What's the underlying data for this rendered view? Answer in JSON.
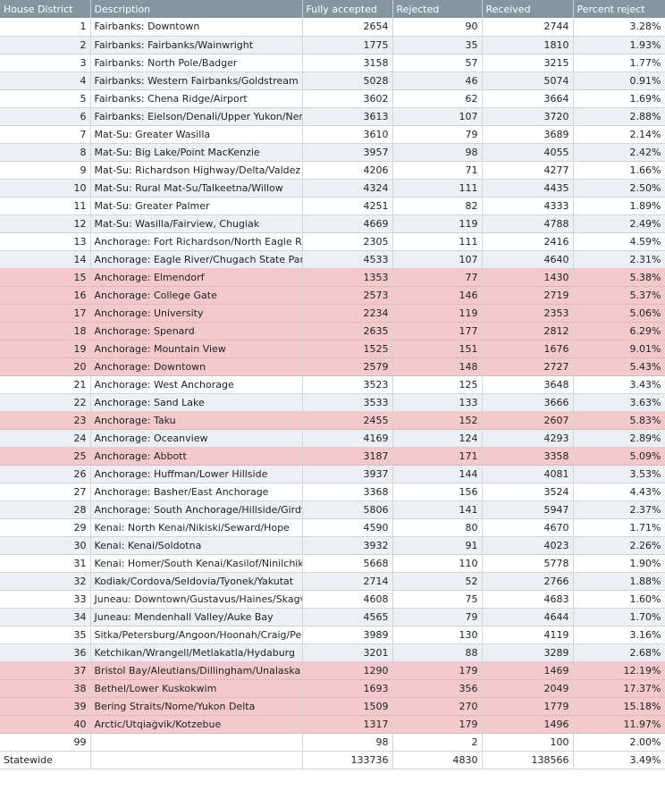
{
  "table": {
    "headers": [
      "House District",
      "Description",
      "Fully accepted",
      "Rejected",
      "Received",
      "Percent reject"
    ],
    "rows": [
      {
        "d": "1",
        "desc": "Fairbanks: Downtown",
        "acc": "2654",
        "rej": "90",
        "rec": "2744",
        "pct": "3.28%",
        "hl": false
      },
      {
        "d": "2",
        "desc": "Fairbanks: Fairbanks/Wainwright",
        "acc": "1775",
        "rej": "35",
        "rec": "1810",
        "pct": "1.93%",
        "hl": false
      },
      {
        "d": "3",
        "desc": "Fairbanks: North Pole/Badger",
        "acc": "3158",
        "rej": "57",
        "rec": "3215",
        "pct": "1.77%",
        "hl": false
      },
      {
        "d": "4",
        "desc": "Fairbanks: Western Fairbanks/Goldstream",
        "acc": "5028",
        "rej": "46",
        "rec": "5074",
        "pct": "0.91%",
        "hl": false
      },
      {
        "d": "5",
        "desc": "Fairbanks: Chena Ridge/Airport",
        "acc": "3602",
        "rej": "62",
        "rec": "3664",
        "pct": "1.69%",
        "hl": false
      },
      {
        "d": "6",
        "desc": "Fairbanks: Eielson/Denali/Upper Yukon/Ner",
        "acc": "3613",
        "rej": "107",
        "rec": "3720",
        "pct": "2.88%",
        "hl": false
      },
      {
        "d": "7",
        "desc": "Mat-Su: Greater Wasilla",
        "acc": "3610",
        "rej": "79",
        "rec": "3689",
        "pct": "2.14%",
        "hl": false
      },
      {
        "d": "8",
        "desc": "Mat-Su: Big Lake/Point MacKenzie",
        "acc": "3957",
        "rej": "98",
        "rec": "4055",
        "pct": "2.42%",
        "hl": false
      },
      {
        "d": "9",
        "desc": "Mat-Su: Richardson Highway/Delta/Valdez",
        "acc": "4206",
        "rej": "71",
        "rec": "4277",
        "pct": "1.66%",
        "hl": false
      },
      {
        "d": "10",
        "desc": "Mat-Su: Rural Mat-Su/Talkeetna/Willow",
        "acc": "4324",
        "rej": "111",
        "rec": "4435",
        "pct": "2.50%",
        "hl": false
      },
      {
        "d": "11",
        "desc": "Mat-Su: Greater Palmer",
        "acc": "4251",
        "rej": "82",
        "rec": "4333",
        "pct": "1.89%",
        "hl": false
      },
      {
        "d": "12",
        "desc": "Mat-Su: Wasilla/Fairview, Chugiak",
        "acc": "4669",
        "rej": "119",
        "rec": "4788",
        "pct": "2.49%",
        "hl": false
      },
      {
        "d": "13",
        "desc": "Anchorage: Fort Richardson/North Eagle Ri",
        "acc": "2305",
        "rej": "111",
        "rec": "2416",
        "pct": "4.59%",
        "hl": false
      },
      {
        "d": "14",
        "desc": "Anchorage: Eagle River/Chugach State Park",
        "acc": "4533",
        "rej": "107",
        "rec": "4640",
        "pct": "2.31%",
        "hl": false
      },
      {
        "d": "15",
        "desc": "Anchorage: Elmendorf",
        "acc": "1353",
        "rej": "77",
        "rec": "1430",
        "pct": "5.38%",
        "hl": true
      },
      {
        "d": "16",
        "desc": "Anchorage: College Gate",
        "acc": "2573",
        "rej": "146",
        "rec": "2719",
        "pct": "5.37%",
        "hl": true
      },
      {
        "d": "17",
        "desc": "Anchorage: University",
        "acc": "2234",
        "rej": "119",
        "rec": "2353",
        "pct": "5.06%",
        "hl": true
      },
      {
        "d": "18",
        "desc": "Anchorage: Spenard",
        "acc": "2635",
        "rej": "177",
        "rec": "2812",
        "pct": "6.29%",
        "hl": true
      },
      {
        "d": "19",
        "desc": "Anchorage: Mountain View",
        "acc": "1525",
        "rej": "151",
        "rec": "1676",
        "pct": "9.01%",
        "hl": true
      },
      {
        "d": "20",
        "desc": "Anchorage: Downtown",
        "acc": "2579",
        "rej": "148",
        "rec": "2727",
        "pct": "5.43%",
        "hl": true
      },
      {
        "d": "21",
        "desc": "Anchorage: West Anchorage",
        "acc": "3523",
        "rej": "125",
        "rec": "3648",
        "pct": "3.43%",
        "hl": false
      },
      {
        "d": "22",
        "desc": "Anchorage: Sand Lake",
        "acc": "3533",
        "rej": "133",
        "rec": "3666",
        "pct": "3.63%",
        "hl": false
      },
      {
        "d": "23",
        "desc": "Anchorage: Taku",
        "acc": "2455",
        "rej": "152",
        "rec": "2607",
        "pct": "5.83%",
        "hl": true
      },
      {
        "d": "24",
        "desc": "Anchorage: Oceanview",
        "acc": "4169",
        "rej": "124",
        "rec": "4293",
        "pct": "2.89%",
        "hl": false
      },
      {
        "d": "25",
        "desc": "Anchorage: Abbott",
        "acc": "3187",
        "rej": "171",
        "rec": "3358",
        "pct": "5.09%",
        "hl": true
      },
      {
        "d": "26",
        "desc": "Anchorage: Huffman/Lower Hillside",
        "acc": "3937",
        "rej": "144",
        "rec": "4081",
        "pct": "3.53%",
        "hl": false
      },
      {
        "d": "27",
        "desc": "Anchorage: Basher/East Anchorage",
        "acc": "3368",
        "rej": "156",
        "rec": "3524",
        "pct": "4.43%",
        "hl": false
      },
      {
        "d": "28",
        "desc": "Anchorage: South Anchorage/Hillside/Girdv",
        "acc": "5806",
        "rej": "141",
        "rec": "5947",
        "pct": "2.37%",
        "hl": false
      },
      {
        "d": "29",
        "desc": "Kenai: North Kenai/Nikiski/Seward/Hope",
        "acc": "4590",
        "rej": "80",
        "rec": "4670",
        "pct": "1.71%",
        "hl": false
      },
      {
        "d": "30",
        "desc": "Kenai: Kenai/Soldotna",
        "acc": "3932",
        "rej": "91",
        "rec": "4023",
        "pct": "2.26%",
        "hl": false
      },
      {
        "d": "31",
        "desc": "Kenai: Homer/South Kenai/Kasilof/Ninilchik",
        "acc": "5668",
        "rej": "110",
        "rec": "5778",
        "pct": "1.90%",
        "hl": false
      },
      {
        "d": "32",
        "desc": "Kodiak/Cordova/Seldovia/Tyonek/Yakutat",
        "acc": "2714",
        "rej": "52",
        "rec": "2766",
        "pct": "1.88%",
        "hl": false
      },
      {
        "d": "33",
        "desc": "Juneau: Downtown/Gustavus/Haines/Skagv",
        "acc": "4608",
        "rej": "75",
        "rec": "4683",
        "pct": "1.60%",
        "hl": false
      },
      {
        "d": "34",
        "desc": "Juneau: Mendenhall Valley/Auke Bay",
        "acc": "4565",
        "rej": "79",
        "rec": "4644",
        "pct": "1.70%",
        "hl": false
      },
      {
        "d": "35",
        "desc": "Sitka/Petersburg/Angoon/Hoonah/Craig/Pe",
        "acc": "3989",
        "rej": "130",
        "rec": "4119",
        "pct": "3.16%",
        "hl": false
      },
      {
        "d": "36",
        "desc": "Ketchikan/Wrangell/Metlakatla/Hydaburg",
        "acc": "3201",
        "rej": "88",
        "rec": "3289",
        "pct": "2.68%",
        "hl": false
      },
      {
        "d": "37",
        "desc": "Bristol Bay/Aleutians/Dillingham/Unalaska",
        "acc": "1290",
        "rej": "179",
        "rec": "1469",
        "pct": "12.19%",
        "hl": true
      },
      {
        "d": "38",
        "desc": "Bethel/Lower Kuskokwim",
        "acc": "1693",
        "rej": "356",
        "rec": "2049",
        "pct": "17.37%",
        "hl": true
      },
      {
        "d": "39",
        "desc": "Bering Straits/Nome/Yukon Delta",
        "acc": "1509",
        "rej": "270",
        "rec": "1779",
        "pct": "15.18%",
        "hl": true
      },
      {
        "d": "40",
        "desc": "Arctic/Utqiaġvik/Kotzebue",
        "acc": "1317",
        "rej": "179",
        "rec": "1496",
        "pct": "11.97%",
        "hl": true
      },
      {
        "d": "99",
        "desc": "",
        "acc": "98",
        "rej": "2",
        "rec": "100",
        "pct": "2.00%",
        "hl": false
      }
    ],
    "total": {
      "label": "Statewide",
      "desc": "",
      "acc": "133736",
      "rej": "4830",
      "rec": "138566",
      "pct": "3.49%"
    }
  },
  "colors": {
    "header_bg": "#8497a1",
    "stripe": "#eceff3",
    "highlight": "#f3c9cc"
  }
}
